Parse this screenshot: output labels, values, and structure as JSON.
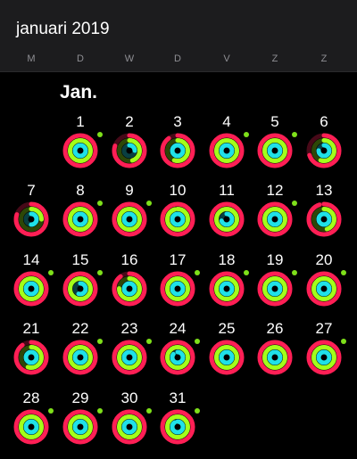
{
  "header": {
    "title": "januari 2019"
  },
  "weekdays": [
    "M",
    "D",
    "W",
    "D",
    "V",
    "Z",
    "Z"
  ],
  "month_label": "Jan.",
  "colors": {
    "move": "#ff1f55",
    "exercise": "#a3ff1a",
    "stand": "#1fe1e8",
    "dot": "#7ee01a"
  },
  "days": [
    {
      "day": "1",
      "move": 1.0,
      "exercise": 1.0,
      "stand": 1.0,
      "closed": true
    },
    {
      "day": "2",
      "move": 0.8,
      "exercise": 0.45,
      "stand": 0.25,
      "closed": false
    },
    {
      "day": "3",
      "move": 0.9,
      "exercise": 0.55,
      "stand": 1.0,
      "closed": false
    },
    {
      "day": "4",
      "move": 1.0,
      "exercise": 1.0,
      "stand": 1.0,
      "closed": true
    },
    {
      "day": "5",
      "move": 1.0,
      "exercise": 1.0,
      "stand": 1.0,
      "closed": true
    },
    {
      "day": "6",
      "move": 0.7,
      "exercise": 0.55,
      "stand": 0.75,
      "closed": false
    },
    {
      "day": "7",
      "move": 0.8,
      "exercise": 0.25,
      "stand": 0.5,
      "closed": false
    },
    {
      "day": "8",
      "move": 1.0,
      "exercise": 1.0,
      "stand": 1.0,
      "closed": true
    },
    {
      "day": "9",
      "move": 1.0,
      "exercise": 1.0,
      "stand": 1.0,
      "closed": true
    },
    {
      "day": "10",
      "move": 1.0,
      "exercise": 0.95,
      "stand": 1.0,
      "closed": false
    },
    {
      "day": "11",
      "move": 1.0,
      "exercise": 1.0,
      "stand": 0.7,
      "closed": false
    },
    {
      "day": "12",
      "move": 1.0,
      "exercise": 1.0,
      "stand": 1.0,
      "closed": true
    },
    {
      "day": "13",
      "move": 0.95,
      "exercise": 0.45,
      "stand": 1.0,
      "closed": false
    },
    {
      "day": "14",
      "move": 1.0,
      "exercise": 1.0,
      "stand": 1.0,
      "closed": true
    },
    {
      "day": "15",
      "move": 1.0,
      "exercise": 1.0,
      "stand": 0.55,
      "closed": true
    },
    {
      "day": "16",
      "move": 0.9,
      "exercise": 0.75,
      "stand": 1.0,
      "closed": false
    },
    {
      "day": "17",
      "move": 1.0,
      "exercise": 1.0,
      "stand": 1.0,
      "closed": true
    },
    {
      "day": "18",
      "move": 1.0,
      "exercise": 1.0,
      "stand": 1.0,
      "closed": true
    },
    {
      "day": "19",
      "move": 1.0,
      "exercise": 1.0,
      "stand": 1.0,
      "closed": true
    },
    {
      "day": "20",
      "move": 1.0,
      "exercise": 1.0,
      "stand": 1.0,
      "closed": true
    },
    {
      "day": "21",
      "move": 0.9,
      "exercise": 0.55,
      "stand": 1.0,
      "closed": false
    },
    {
      "day": "22",
      "move": 1.0,
      "exercise": 1.0,
      "stand": 1.0,
      "closed": true
    },
    {
      "day": "23",
      "move": 1.0,
      "exercise": 1.0,
      "stand": 1.0,
      "closed": true
    },
    {
      "day": "24",
      "move": 1.0,
      "exercise": 1.0,
      "stand": 0.85,
      "closed": true
    },
    {
      "day": "25",
      "move": 1.0,
      "exercise": 1.0,
      "stand": 1.0,
      "closed": false
    },
    {
      "day": "26",
      "move": 1.0,
      "exercise": 1.0,
      "stand": 1.0,
      "closed": false
    },
    {
      "day": "27",
      "move": 1.0,
      "exercise": 1.0,
      "stand": 1.0,
      "closed": true
    },
    {
      "day": "28",
      "move": 1.0,
      "exercise": 1.0,
      "stand": 1.0,
      "closed": true
    },
    {
      "day": "29",
      "move": 1.0,
      "exercise": 1.0,
      "stand": 1.0,
      "closed": true
    },
    {
      "day": "30",
      "move": 1.0,
      "exercise": 1.0,
      "stand": 1.0,
      "closed": true
    },
    {
      "day": "31",
      "move": 1.0,
      "exercise": 1.0,
      "stand": 0.9,
      "closed": true
    }
  ]
}
